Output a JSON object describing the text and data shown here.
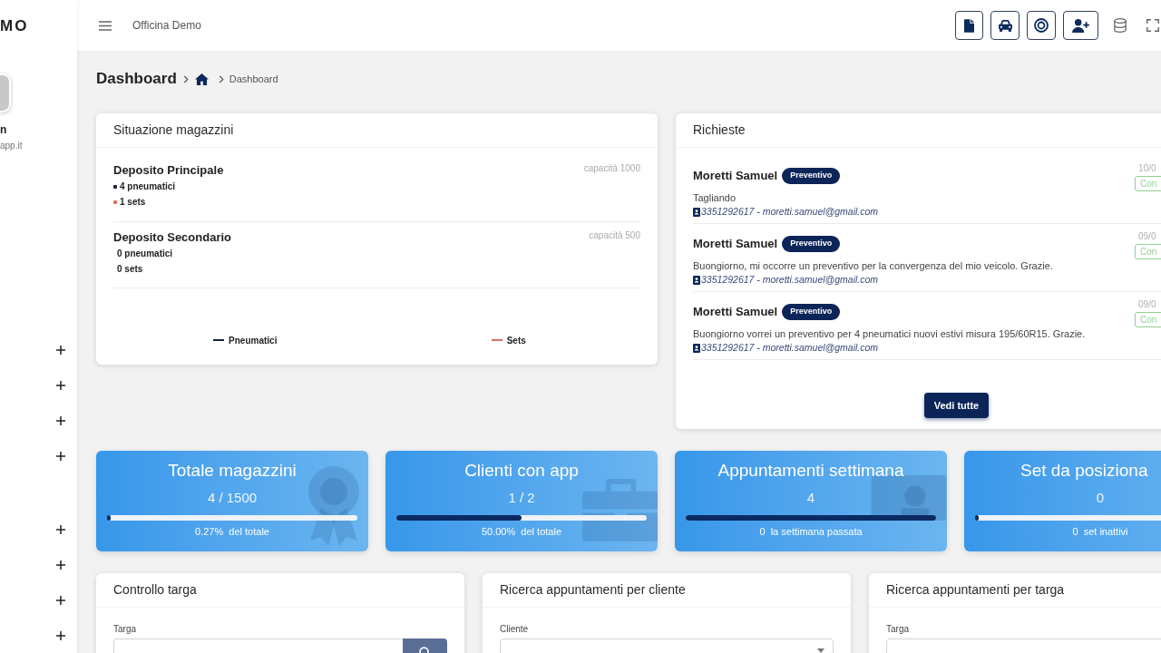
{
  "sidebar": {
    "logo": "MO",
    "user_name": "n",
    "user_email": "app.it",
    "sections": [
      {
        "items": [
          {
            "expanded": false
          },
          {
            "expanded": false
          },
          {
            "expanded": false
          },
          {
            "expanded": false
          }
        ]
      },
      {
        "items": [
          {
            "expanded": false
          },
          {
            "expanded": false
          },
          {
            "expanded": false
          },
          {
            "expanded": false
          }
        ]
      }
    ]
  },
  "topbar": {
    "title": "Officina Demo"
  },
  "breadcrumb": {
    "title": "Dashboard",
    "current": "Dashboard"
  },
  "warehouses": {
    "title": "Situazione magazzini",
    "depots": [
      {
        "name": "Deposito Principale",
        "capacity": "capacità 1000",
        "stock": [
          {
            "text": "4 pneumatici",
            "color": "#1b2440"
          },
          {
            "text": "1 sets",
            "color": "#e0705a"
          }
        ]
      },
      {
        "name": "Deposito Secondario",
        "capacity": "capacità 500",
        "stock": [
          {
            "text": "0 pneumatici"
          },
          {
            "text": "0 sets"
          }
        ]
      }
    ],
    "legend": [
      {
        "label": "Pneumatici",
        "color": "#16213e"
      },
      {
        "label": "Sets",
        "color": "#d9735f"
      }
    ]
  },
  "requests": {
    "title": "Richieste",
    "items": [
      {
        "name": "Moretti Samuel",
        "badge": "Preventivo",
        "date": "10/0",
        "status": "Con",
        "description": "Tagliando",
        "contact": "3351292617 - moretti.samuel@gmail.com"
      },
      {
        "name": "Moretti Samuel",
        "badge": "Preventivo",
        "date": "09/0",
        "status": "Con",
        "description": "Buongiorno, mi occorre un preventivo per la convergenza del mio veicolo. Grazie.",
        "contact": "3351292617 - moretti.samuel@gmail.com"
      },
      {
        "name": "Moretti Samuel",
        "badge": "Preventivo",
        "date": "09/0",
        "status": "Con",
        "description": "Buongiorno vorrei un preventivo per 4 pneumatici nuovi estivi misura 195/60R15. Grazie.",
        "contact": "3351292617 - moretti.samuel@gmail.com"
      }
    ],
    "button": "Vedi tutte"
  },
  "stats": [
    {
      "title": "Totale magazzini",
      "value": "4 / 1500",
      "level": 0.0027,
      "note": "0.27%  del totale"
    },
    {
      "title": "Clienti con app",
      "value": "1 / 2",
      "level": 0.5,
      "note": "50.00%  del totale"
    },
    {
      "title": "Appuntamenti settimana",
      "value": "4",
      "level": 1,
      "note": "0  la settimana passata"
    },
    {
      "title": "Set da posiziona",
      "value": "0",
      "level": 0,
      "note": "0  set inattivi"
    }
  ],
  "forms": [
    {
      "title": "Controllo targa",
      "label": "Targa",
      "kind": "search"
    },
    {
      "title": "Ricerca appuntamenti per cliente",
      "label": "Cliente",
      "kind": "select"
    },
    {
      "title": "Ricerca appuntamenti per targa",
      "label": "Targa",
      "kind": "text"
    }
  ]
}
